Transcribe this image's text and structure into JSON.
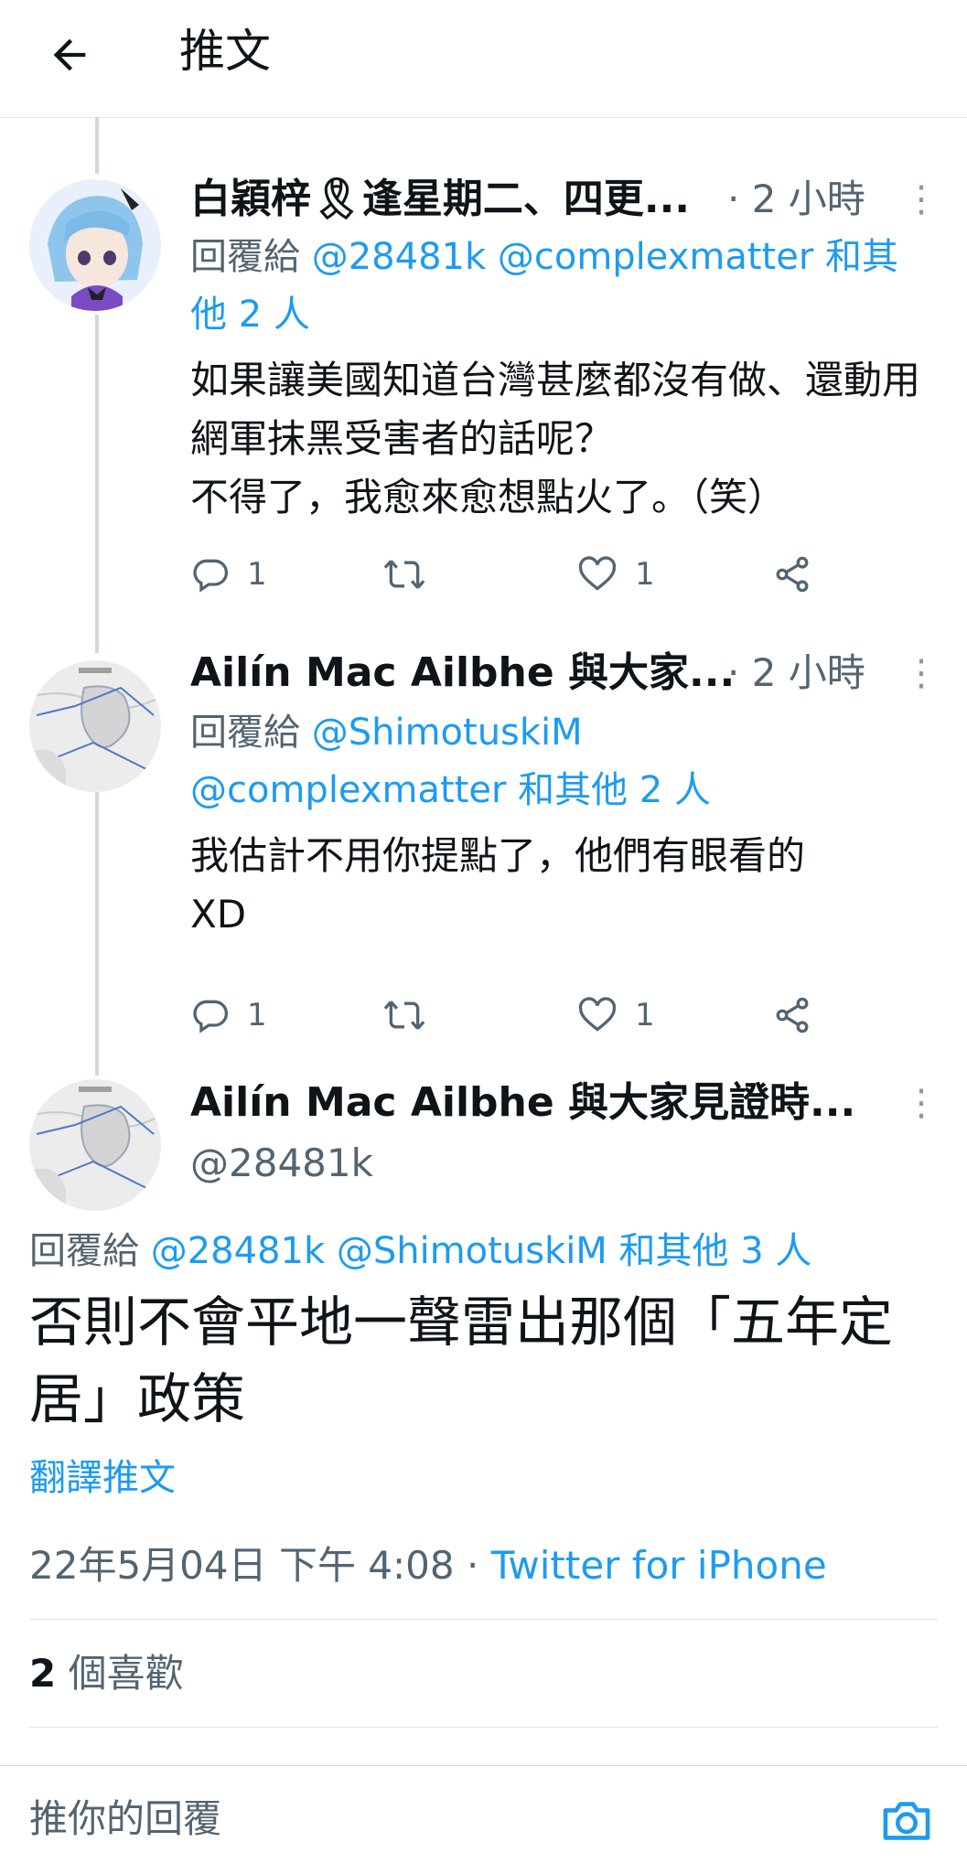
{
  "header": {
    "title": "推文",
    "back_icon": "arrow-left-icon"
  },
  "tweets": [
    {
      "display_name": "白穎梓🎗逢星期二、四更...",
      "time": "· 2 小時",
      "reply_prefix": "回覆給",
      "mentions": [
        "@28481k",
        "@complexmatter"
      ],
      "reply_suffix": "和其他 2 人",
      "text": "如果讓美國知道台灣甚麼都沒有做、還動用網軍抹黑受害者的話呢？\n不得了，我愈來愈想點火了。（笑）",
      "reply_count": "1",
      "retweet_count": "",
      "like_count": "1"
    },
    {
      "display_name": "Ailín Mac Ailbhe 與大家...",
      "time": "· 2 小時",
      "reply_prefix": "回覆給",
      "mentions": [
        "@ShimotuskiM",
        "@complexmatter"
      ],
      "reply_suffix": "和其他 2 人",
      "text": "我估計不用你提點了，他們有眼看的\nXD",
      "reply_count": "1",
      "retweet_count": "",
      "like_count": "1"
    }
  ],
  "main_tweet": {
    "display_name": "Ailín Mac Ailbhe 與大家見證時...",
    "handle": "@28481k",
    "reply_prefix": "回覆給",
    "mentions": [
      "@28481k",
      "@ShimotuskiM"
    ],
    "reply_suffix": "和其他 3 人",
    "text": "否則不會平地一聲雷出那個「五年定居」政策",
    "translate_label": "翻譯推文",
    "timestamp": "22年5月04日 下午 4:08 · ",
    "source": "Twitter for iPhone",
    "like_count": "2",
    "like_label": " 個喜歡"
  },
  "composer": {
    "placeholder": "推你的回覆",
    "camera_icon": "camera-icon"
  },
  "colors": {
    "accent": "#1d9bf0",
    "secondary_text": "#536471",
    "divider": "#e1e5e8"
  }
}
